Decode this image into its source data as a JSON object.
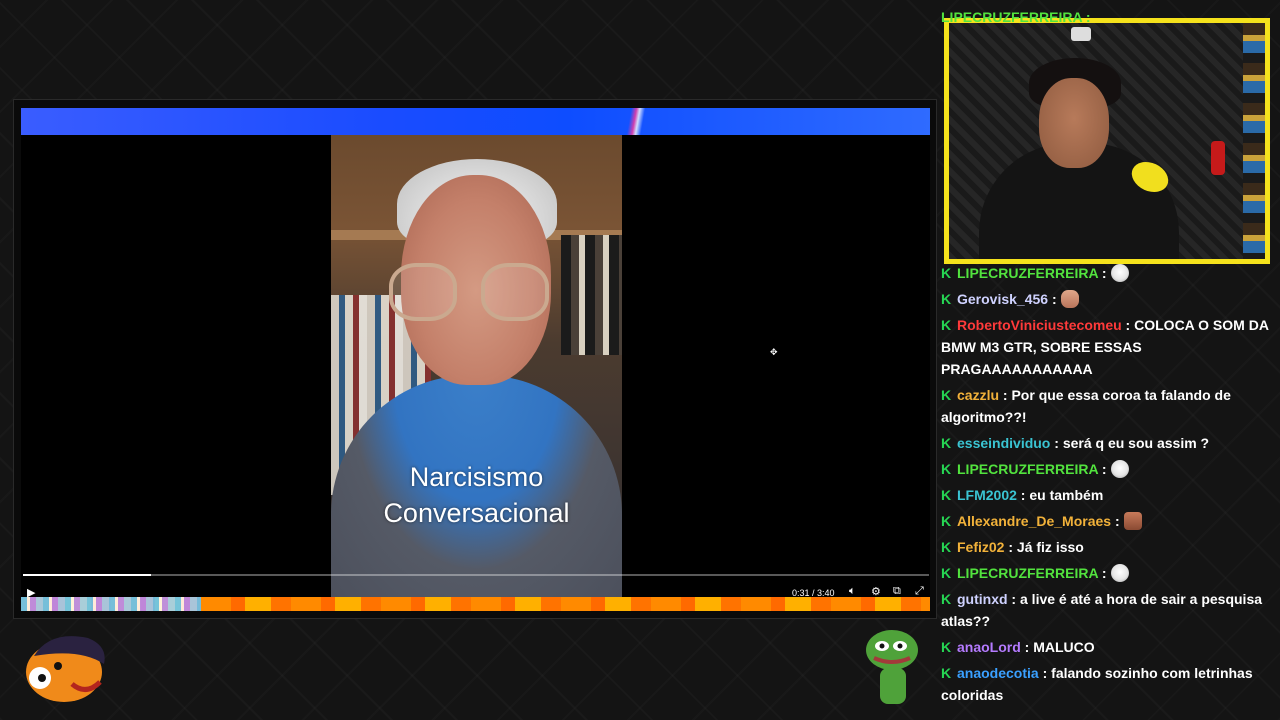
{
  "video": {
    "caption_line1": "Narcisismo",
    "caption_line2": "Conversacional",
    "time": "0:31 / 3:40",
    "progress": 0.141
  },
  "chat": {
    "cutoff_top_user": "LIPECRUZFERREIRA :",
    "messages": [
      {
        "user": "LIPECRUZFERREIRA",
        "color": "#52e33e",
        "text": "",
        "emote": "ghost-emote"
      },
      {
        "user": "Gerovisk_456",
        "color": "#cfd2ff",
        "text": "",
        "emote": "hand-emote"
      },
      {
        "user": "RobertoViniciustecomeu",
        "color": "#ff3a3a",
        "text": "COLOCA O SOM DA BMW M3 GTR, SOBRE ESSAS PRAGAAAAAAAAAAA",
        "emote": ""
      },
      {
        "user": "cazzlu",
        "color": "#f2b23a",
        "text": "Por que essa coroa ta falando de algoritmo??!",
        "emote": ""
      },
      {
        "user": "esseindividuo",
        "color": "#3ac4d2",
        "text": "será q eu sou assim ?",
        "emote": ""
      },
      {
        "user": "LIPECRUZFERREIRA",
        "color": "#52e33e",
        "text": "",
        "emote": "ghost-emote"
      },
      {
        "user": "LFM2002",
        "color": "#3ac4d2",
        "text": "eu também",
        "emote": ""
      },
      {
        "user": "Allexandre_De_Moraes",
        "color": "#f2b23a",
        "text": "",
        "emote": "face-emote"
      },
      {
        "user": "Fefiz02",
        "color": "#f2b23a",
        "text": "Já fiz isso",
        "emote": ""
      },
      {
        "user": "LIPECRUZFERREIRA",
        "color": "#52e33e",
        "text": "",
        "emote": "ghost-emote"
      },
      {
        "user": "gutinxd",
        "color": "#cfd2ff",
        "text": "a live é até a hora de sair a pesquisa atlas??",
        "emote": ""
      },
      {
        "user": "anaoLord",
        "color": "#b57bff",
        "text": "MALUCO",
        "emote": ""
      },
      {
        "user": "anaodecotia",
        "color": "#3aa0ff",
        "text": "falando sozinho com letrinhas coloridas",
        "emote": ""
      }
    ]
  }
}
